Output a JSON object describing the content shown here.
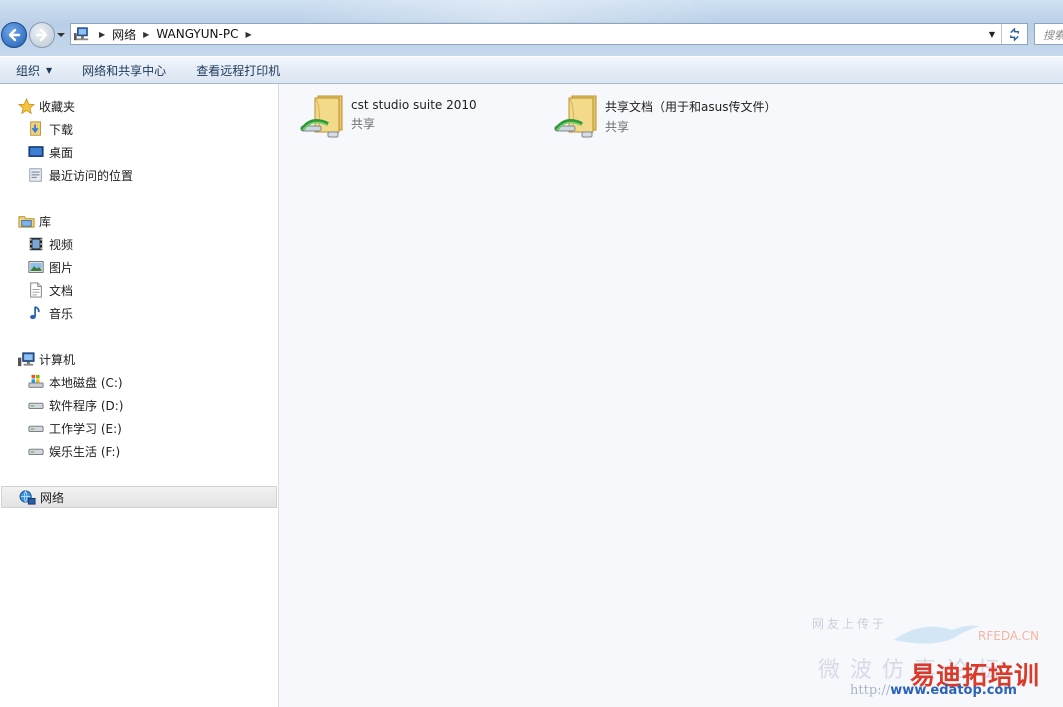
{
  "address_bar": {
    "crumbs": [
      "网络",
      "WANGYUN-PC"
    ],
    "search_placeholder": "搜索"
  },
  "command_bar": {
    "organize": "组织",
    "network_center": "网络和共享中心",
    "printers": "查看远程打印机"
  },
  "nav_pane": {
    "favorites": {
      "label": "收藏夹",
      "items": [
        "下载",
        "桌面",
        "最近访问的位置"
      ]
    },
    "libraries": {
      "label": "库",
      "items": [
        "视频",
        "图片",
        "文档",
        "音乐"
      ]
    },
    "computer": {
      "label": "计算机",
      "items": [
        "本地磁盘 (C:)",
        "软件程序 (D:)",
        "工作学习 (E:)",
        "娱乐生活 (F:)"
      ]
    },
    "network": {
      "label": "网络"
    }
  },
  "content": {
    "shares": [
      {
        "name": "cst studio suite 2010",
        "status": "共享"
      },
      {
        "name": "共享文档（用于和asus传文件）",
        "status": "共享"
      }
    ]
  },
  "watermark": {
    "tagline": "网友上传于",
    "site_brand": "RFEDA.CN",
    "big_text": "微波仿真论坛",
    "red_text": "易迪拓培训",
    "url_prefix": "http://",
    "url_domain": "www.edatop.com"
  },
  "colors": {
    "titlebar": "#c6d8ec",
    "accent_blue": "#2160b4",
    "nav_bg": "#ffffff",
    "content_bg": "#f7f8fb",
    "watermark_red": "#d93a2a"
  }
}
